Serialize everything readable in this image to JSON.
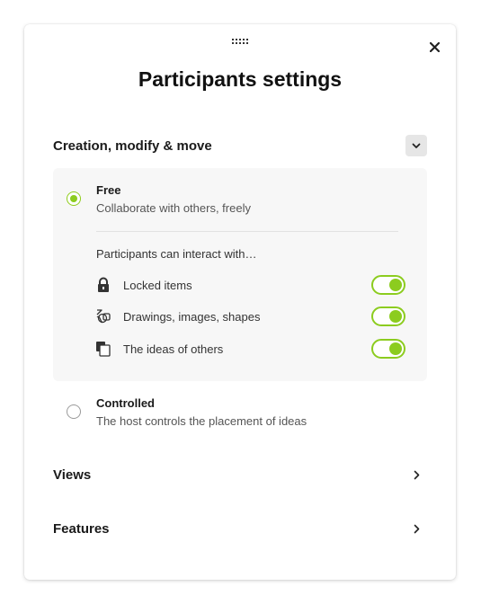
{
  "dialog": {
    "title": "Participants settings",
    "close_icon": "close-icon",
    "drag_icon": "drag-handle-icon"
  },
  "creation_section": {
    "title": "Creation, modify & move",
    "expanded": true,
    "toggle_icon": "chevron-down-icon"
  },
  "modes": {
    "free": {
      "title": "Free",
      "description": "Collaborate with others, freely",
      "selected": true
    },
    "interact_label": "Participants can interact with…",
    "permissions": [
      {
        "label": "Locked items",
        "icon": "lock-icon",
        "enabled": true
      },
      {
        "label": "Drawings, images, shapes",
        "icon": "shapes-icon",
        "enabled": true
      },
      {
        "label": "The ideas of others",
        "icon": "ideas-icon",
        "enabled": true
      }
    ],
    "controlled": {
      "title": "Controlled",
      "description": "The host controls the placement of ideas",
      "selected": false
    }
  },
  "sections": [
    {
      "title": "Views",
      "icon": "chevron-right-icon"
    },
    {
      "title": "Features",
      "icon": "chevron-right-icon"
    }
  ],
  "colors": {
    "accent": "#8ccc1f",
    "panel_option_bg": "#f7f7f7",
    "collapse_button_bg": "#e6e6e6"
  }
}
